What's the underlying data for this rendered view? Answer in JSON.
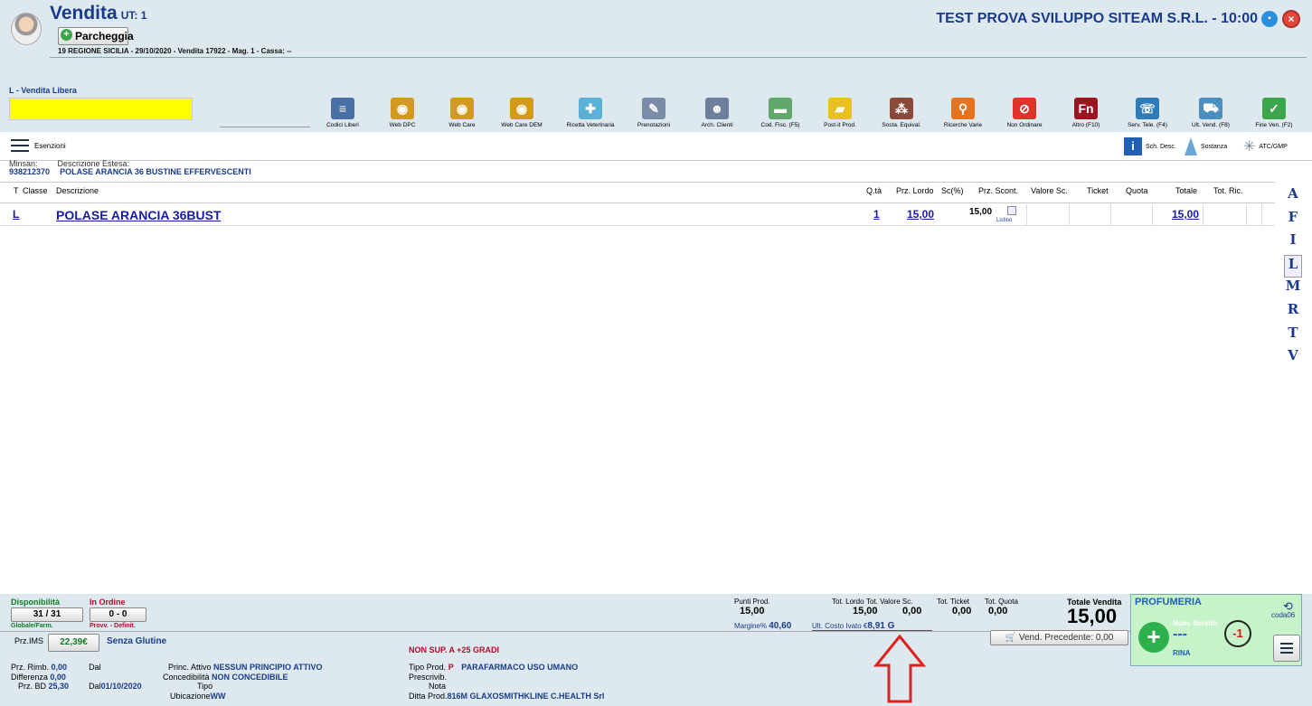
{
  "header": {
    "title": "Vendita",
    "ut": "UT: 1",
    "park_label": "Parcheggia",
    "info": "19 REGIONE SICILIA - 29/10/2020 - Vendita 17922 - Mag. 1 - Cassa: --",
    "company": "TEST PROVA SVILUPPO SITEAM S.R.L. - 10:00"
  },
  "sale_mode": "L - Vendita Libera",
  "toolbar": [
    {
      "label": "Codici Liberi",
      "icon": "list-icon",
      "color": "#4a6fa5"
    },
    {
      "label": "Web DPC",
      "icon": "web-icon",
      "color": "#d29b1e"
    },
    {
      "label": "Web Care",
      "icon": "web-icon",
      "color": "#d29b1e"
    },
    {
      "label": "Web Care DEM",
      "icon": "web-icon",
      "color": "#d29b1e"
    },
    {
      "label": "Ricetta Veterinaria",
      "icon": "paw-icon",
      "color": "#5bb0d8"
    },
    {
      "label": "Prenotazioni",
      "icon": "notepad-icon",
      "color": "#7a8ca8"
    },
    {
      "label": "Arch. Clienti",
      "icon": "users-icon",
      "color": "#6d7f9a"
    },
    {
      "label": "Cod. Fisc. (F5)",
      "icon": "card-icon",
      "color": "#62a86a"
    },
    {
      "label": "Post-it Prod.",
      "icon": "postit-icon",
      "color": "#e9c023"
    },
    {
      "label": "Sosta. Equival.",
      "icon": "pills-icon",
      "color": "#8a4a3a"
    },
    {
      "label": "Ricerche Varie",
      "icon": "search-icon",
      "color": "#e8731f"
    },
    {
      "label": "Non Ordinare",
      "icon": "forbidden-icon",
      "color": "#e1322a"
    },
    {
      "label": "Altro (F10)",
      "icon": "fn-icon",
      "color": "#9c1420"
    },
    {
      "label": "Serv. Tele. (F4)",
      "icon": "tele-icon",
      "color": "#2e7bb5"
    },
    {
      "label": "Ult. Vend. (F8)",
      "icon": "cart-icon",
      "color": "#4a8fc0"
    },
    {
      "label": "Fine Ven. (F2)",
      "icon": "cart-check-icon",
      "color": "#3aa54a"
    }
  ],
  "sub": {
    "esenzioni": "Esenzioni",
    "sch_desc": "Sch. Desc.",
    "sostanza": "Sostanza",
    "atc": "ATC/GMP"
  },
  "product": {
    "minsan_label": "Minsan:",
    "minsan": "938212370",
    "desc_label": "Descrizione Estesa:",
    "desc": "POLASE ARANCIA 36 BUSTINE EFFERVESCENTI"
  },
  "table": {
    "headers": {
      "t": "T",
      "classe": "Classe",
      "descrizione": "Descrizione",
      "qta": "Q.tà",
      "prz_lordo": "Prz. Lordo",
      "sc": "Sc(%)",
      "prz_scont": "Prz. Scont.",
      "valore_sc": "Valore Sc.",
      "ticket": "Ticket",
      "quota": "Quota",
      "totale": "Totale",
      "tot_ric": "Tot. Ric."
    },
    "row": {
      "t": "L",
      "descrizione": "POLASE ARANCIA 36BUST",
      "qta": "1",
      "prz_lordo": "15,00",
      "prz_scont": "15,00",
      "listino": "Listino",
      "totale": "15,00"
    }
  },
  "letters": [
    "A",
    "F",
    "I",
    "L",
    "M",
    "R",
    "T",
    "V"
  ],
  "footer": {
    "disp_label": "Disponibilità",
    "disp_value": "31 / 31",
    "disp_sub": "Globale/Farm.",
    "ord_label": "In Ordine",
    "ord_value": "0 - 0",
    "ord_sub": "Provv. - Definit.",
    "prz_ims_label": "Prz.IMS",
    "prz_ims": "22,39€",
    "senza_glutine": "Senza Glutine",
    "non_sup": "NON SUP. A +25 GRADI",
    "punti_label": "Punti Prod.",
    "punti": "15,00",
    "tot_lordo_label": "Tot. Lordo",
    "tot_lordo": "15,00",
    "tot_val_label": "Tot. Valore Sc.",
    "tot_val": "0,00",
    "tot_ticket_label": "Tot. Ticket",
    "tot_ticket": "0,00",
    "tot_quota_label": "Tot. Quota",
    "tot_quota": "0,00",
    "totale_label": "Totale Vendita",
    "totale": "15,00",
    "margine_label": "Margine%",
    "margine": "40,60",
    "ult_costo_label": "Ult. Costo Ivato €",
    "ult_costo": "8,91 G",
    "vend_prec": "Vend. Precedente: 0,00",
    "profumeria": "PROFUMERIA",
    "num_servito": "Num. Servito",
    "num": "---",
    "rina": "RINA",
    "coda": "coda06",
    "counter": "-1",
    "rimb_label": "Prz. Rimb.",
    "rimb": "0,00",
    "diff_label": "Differenza",
    "diff": "0,00",
    "bd_label": "Prz. BD",
    "bd": "25,30",
    "dal_label": "Dal",
    "dal2_label": "Dal",
    "dal2": "01/10/2020",
    "princ_label": "Princ. Attivo",
    "princ": "NESSUN PRINCIPIO ATTIVO",
    "conc_label": "Concedibilità",
    "conc": "NON CONCEDIBILE",
    "tipo_label": "Tipo",
    "ubic_label": "Ubicazione",
    "ubic": "WW",
    "tipo_prod_label": "Tipo Prod.",
    "tipo_prod_code": "P",
    "tipo_prod": "PARAFARMACO USO UMANO",
    "prescr_label": "Prescrivib.",
    "nota_label": "Nota",
    "ditta_label": "Ditta Prod.",
    "ditta": "816M GLAXOSMITHKLINE C.HEALTH Srl"
  }
}
